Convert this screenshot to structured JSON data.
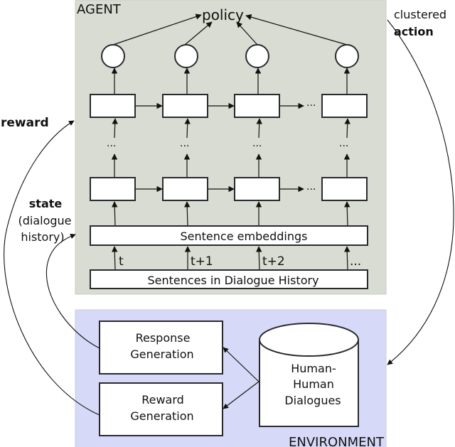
{
  "agent": {
    "label": "AGENT",
    "policy_label": "policy",
    "ellipsis": "···",
    "embeddings_label": "Sentence embeddings",
    "sentences_label": "Sentences in Dialogue History",
    "time_labels": [
      "t",
      "t+1",
      "t+2",
      "..."
    ]
  },
  "environment": {
    "label": "ENVIRONMENT",
    "response_generation": [
      "Response",
      "Generation"
    ],
    "reward_generation": [
      "Reward",
      "Generation"
    ],
    "database": [
      "Human-",
      "Human",
      "Dialogues"
    ]
  },
  "edges": {
    "reward_label": "reward",
    "state_label": "state",
    "state_sublabel_1": "(dialogue",
    "state_sublabel_2": "history)",
    "action_label_1": "clustered",
    "action_label_2": "action"
  },
  "colors": {
    "agent_bg": "#d8dcd2",
    "environment_bg": "#d6d9f7",
    "stroke": "#2a2a2e"
  }
}
